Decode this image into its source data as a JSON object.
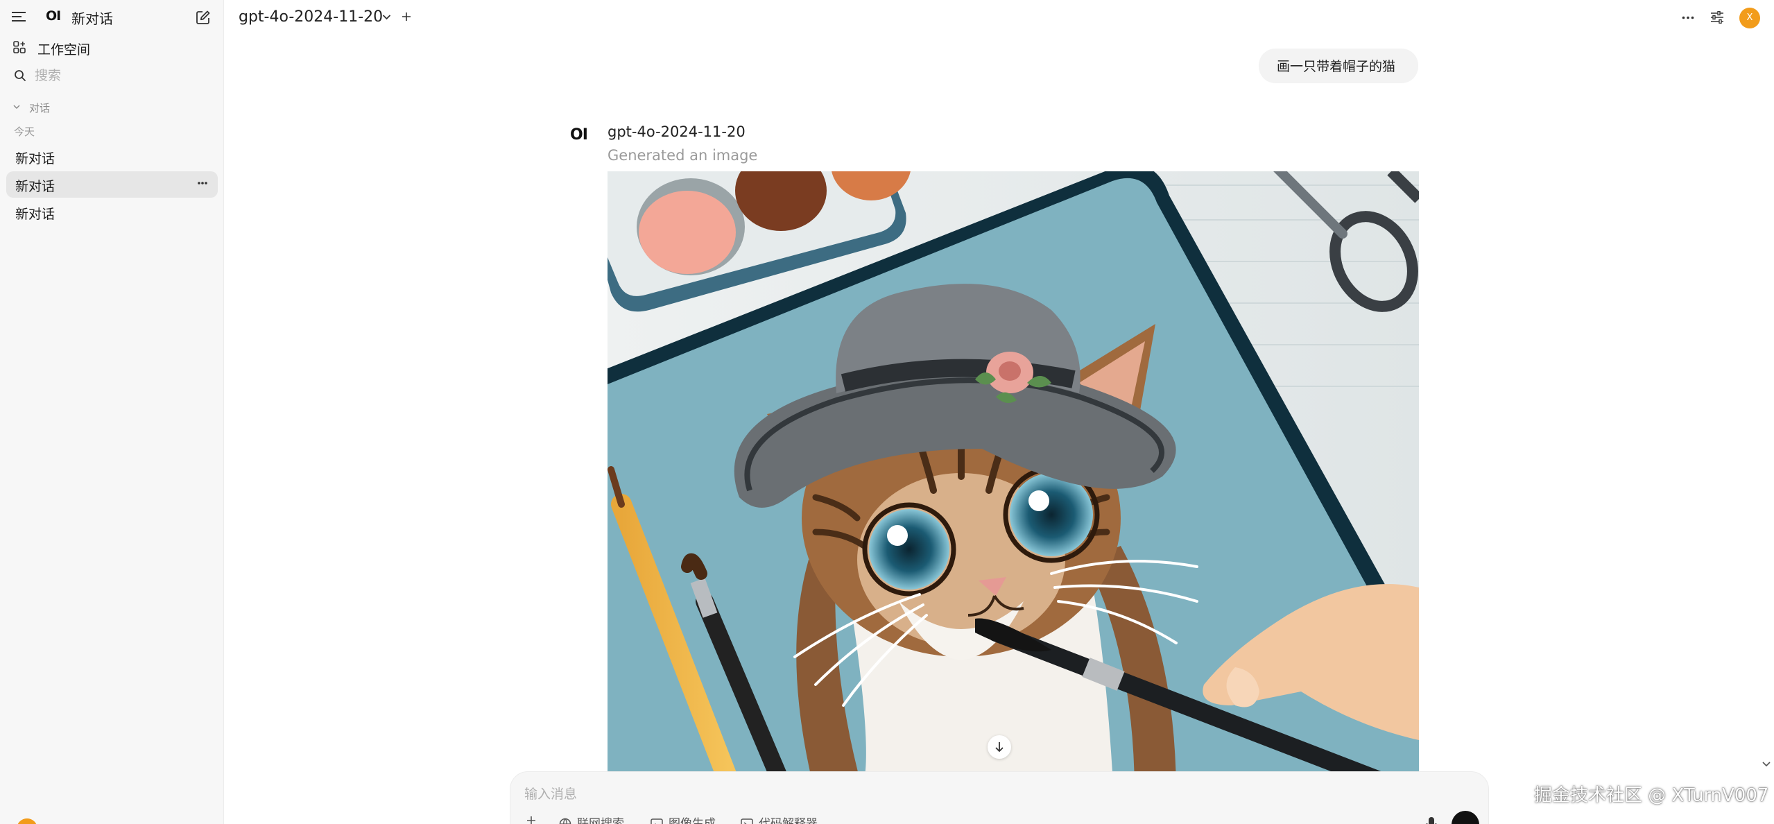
{
  "sidebar": {
    "logo_text": "OI",
    "title": "新对话",
    "workspace_label": "工作空间",
    "search_placeholder": "搜索",
    "section_label": "对话",
    "group_label": "今天",
    "chats": [
      {
        "label": "新对话"
      },
      {
        "label": "新对话",
        "active": true
      },
      {
        "label": "新对话"
      }
    ]
  },
  "header": {
    "model_name": "gpt-4o-2024-11-20",
    "avatar_letter": "X"
  },
  "conversation": {
    "user_message": "画一只带着帽子的猫",
    "assistant_logo_text": "OI",
    "assistant_model": "gpt-4o-2024-11-20",
    "assistant_status": "Generated an image",
    "image_subject": "Illustrated cat wearing a grey hat with a flower, being painted with a brush on a blue canvas"
  },
  "composer": {
    "placeholder": "输入消息",
    "tools": [
      {
        "label": "联网搜索",
        "icon": "globe-icon"
      },
      {
        "label": "图像生成",
        "icon": "image-icon"
      },
      {
        "label": "代码解释器",
        "icon": "code-icon"
      }
    ]
  },
  "watermark": "掘金技术社区 @ XTurnV007",
  "colors": {
    "sidebar_bg": "#f7f7f7",
    "active_chat_bg": "#e6e6e6",
    "avatar": "#f29c1b",
    "canvas_blue": "#7fb2c0"
  }
}
